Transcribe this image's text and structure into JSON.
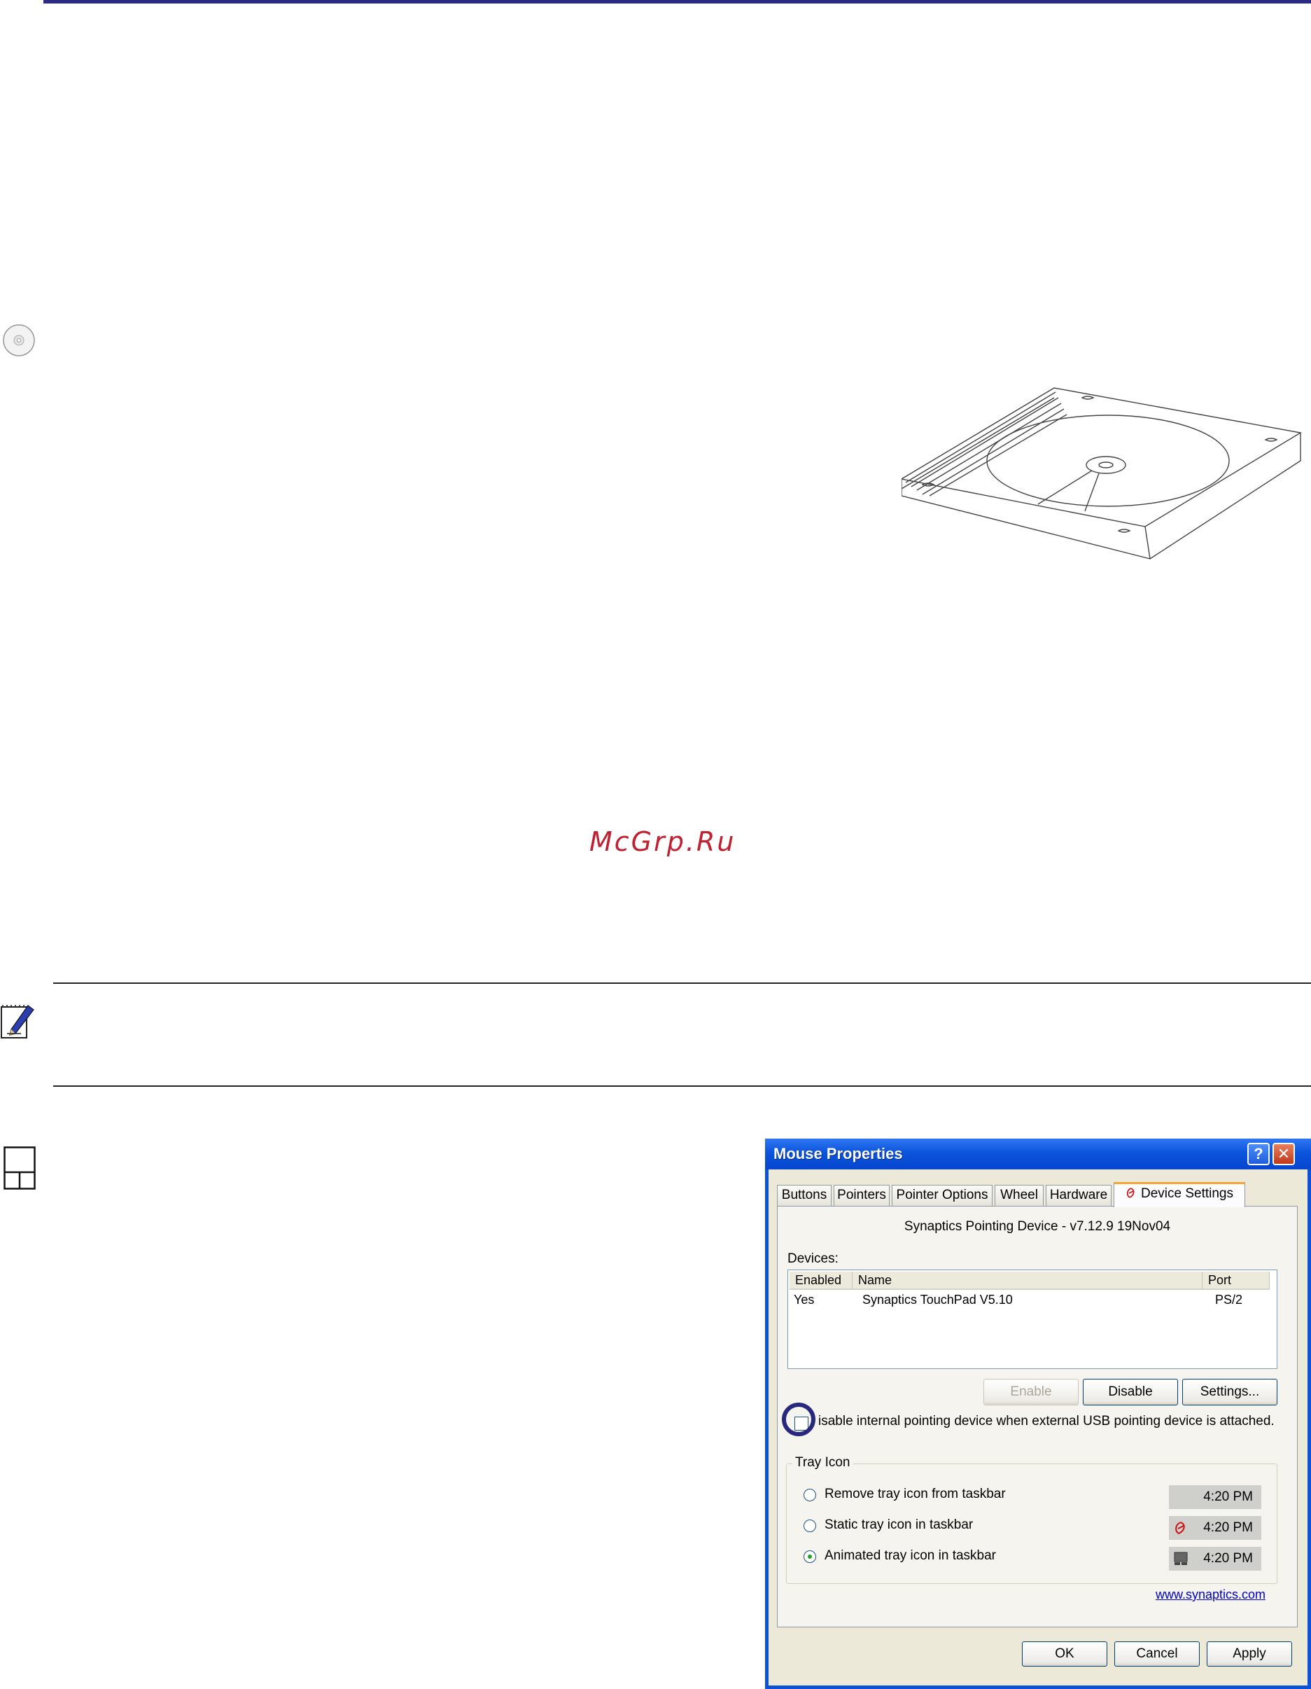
{
  "watermark": "McGrp.Ru",
  "dialog": {
    "title": "Mouse Properties",
    "help_glyph": "?",
    "close_glyph": "✕",
    "tabs": [
      "Buttons",
      "Pointers",
      "Pointer Options",
      "Wheel",
      "Hardware",
      "Device Settings"
    ],
    "active_tab": "Device Settings",
    "heading": "Synaptics Pointing Device - v7.12.9 19Nov04",
    "devices_label": "Devices:",
    "columns": [
      "Enabled",
      "Name",
      "Port"
    ],
    "rows": [
      {
        "enabled": "Yes",
        "name": "Synaptics TouchPad V5.10",
        "port": "PS/2"
      }
    ],
    "buttons": {
      "enable": "Enable",
      "disable": "Disable",
      "settings": "Settings..."
    },
    "checkbox_label": "isable internal pointing device when external USB pointing device is attached.",
    "checkbox_checked": false,
    "tray": {
      "legend": "Tray Icon",
      "options": [
        {
          "label": "Remove tray icon from taskbar",
          "time": "4:20 PM",
          "checked": false
        },
        {
          "label": "Static tray icon in taskbar",
          "time": "4:20 PM",
          "checked": false
        },
        {
          "label": "Animated tray icon in taskbar",
          "time": "4:20 PM",
          "checked": true
        }
      ]
    },
    "link": "www.synaptics.com",
    "footer": {
      "ok": "OK",
      "cancel": "Cancel",
      "apply": "Apply"
    }
  },
  "colors": {
    "accent": "#2c2a86",
    "watermark": "#c02030",
    "xp_blue": "#0a52d8"
  },
  "icons": [
    "disc-icon",
    "note-pencil-icon",
    "touchpad-icon",
    "cd-case-illustration",
    "synaptics-icon"
  ]
}
